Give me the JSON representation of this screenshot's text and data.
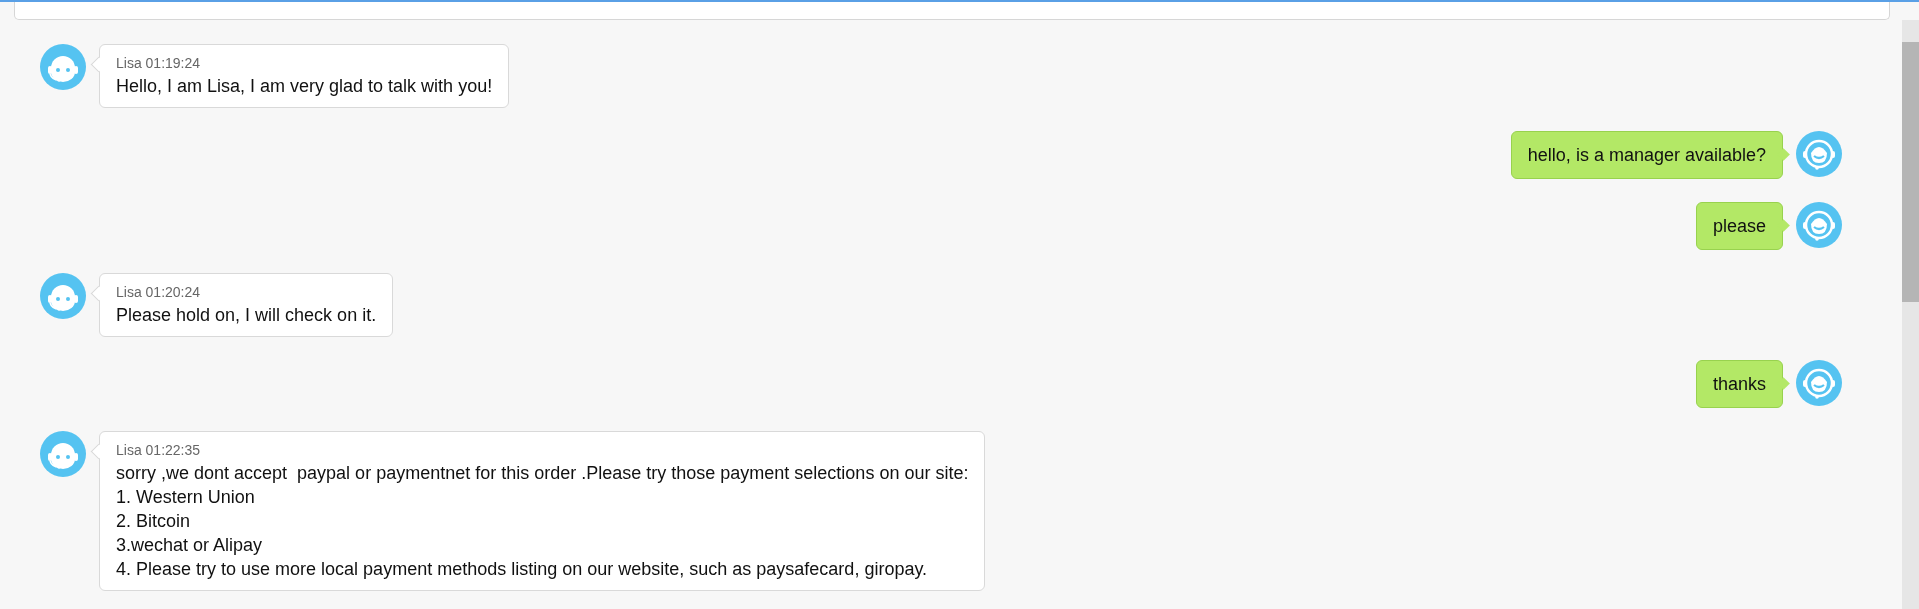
{
  "messages": [
    {
      "kind": "agent",
      "sender": "Lisa",
      "time": "01:19:24",
      "text": "Hello, I am Lisa, I am very glad to talk with you!"
    },
    {
      "kind": "user",
      "text": "hello, is a manager available?"
    },
    {
      "kind": "user",
      "text": "please"
    },
    {
      "kind": "agent",
      "sender": "Lisa",
      "time": "01:20:24",
      "text": "Please hold on, I will check on it."
    },
    {
      "kind": "user",
      "text": "thanks"
    },
    {
      "kind": "agent",
      "sender": "Lisa",
      "time": "01:22:35",
      "text": "sorry ,we dont accept  paypal or paymentnet for this order .Please try those payment selections on our site:\n1. Western Union\n2. Bitcoin\n3.wechat or Alipay\n4. Please try to use more local payment methods listing on our website, such as paysafecard, giropay."
    }
  ]
}
